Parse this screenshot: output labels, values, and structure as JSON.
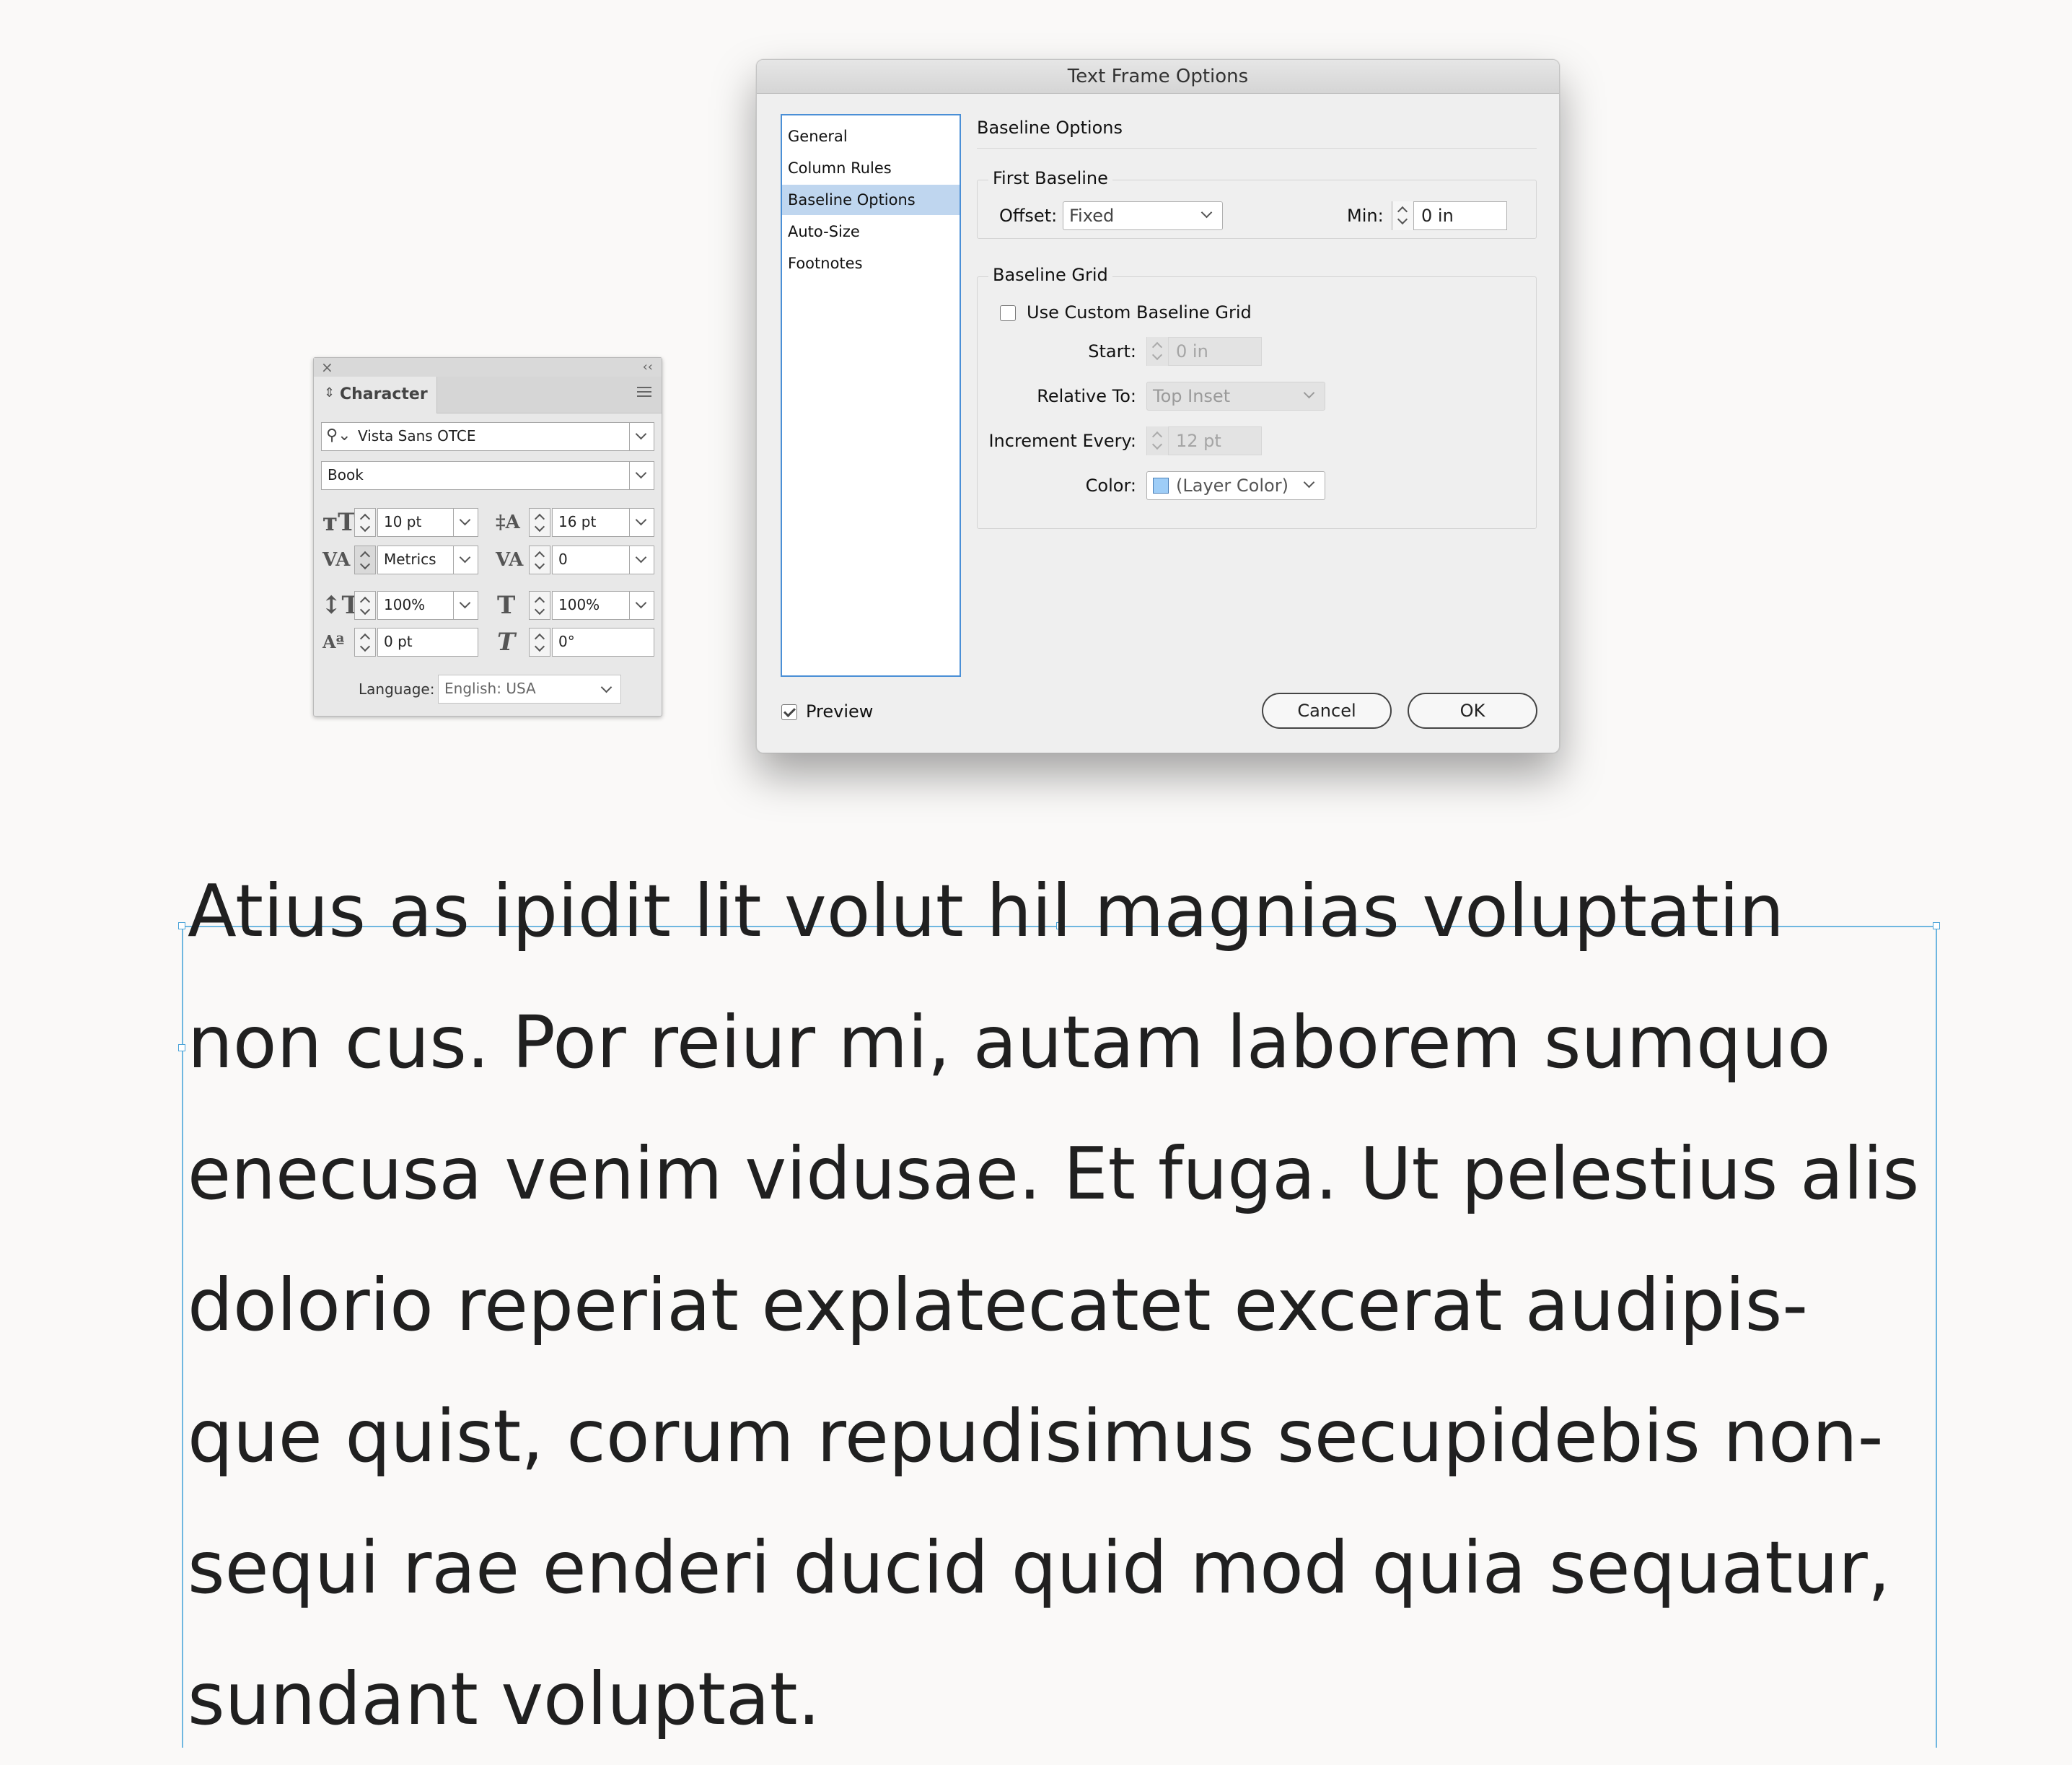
{
  "character_panel": {
    "tab_label": "Character",
    "font_family": "Vista Sans OTCE",
    "font_style": "Book",
    "font_size": "10 pt",
    "leading": "16 pt",
    "kerning": "Metrics",
    "tracking": "0",
    "vertical_scale": "100%",
    "horizontal_scale": "100%",
    "baseline_shift": "0 pt",
    "skew": "0°",
    "language_label": "Language:",
    "language": "English: USA"
  },
  "dialog": {
    "title": "Text Frame Options",
    "nav_items": [
      "General",
      "Column Rules",
      "Baseline Options",
      "Auto-Size",
      "Footnotes"
    ],
    "selected_nav": "Baseline Options",
    "section_title": "Baseline Options",
    "first_baseline": {
      "group_label": "First Baseline",
      "offset_label": "Offset:",
      "offset_value": "Fixed",
      "min_label": "Min:",
      "min_value": "0 in"
    },
    "baseline_grid": {
      "group_label": "Baseline Grid",
      "use_custom_label": "Use Custom Baseline Grid",
      "use_custom_checked": false,
      "start_label": "Start:",
      "start_value": "0 in",
      "relative_to_label": "Relative To:",
      "relative_to_value": "Top Inset",
      "increment_label": "Increment Every:",
      "increment_value": "12 pt",
      "color_label": "Color:",
      "color_value": "(Layer Color)",
      "color_swatch": "#9ecdf7"
    },
    "preview_label": "Preview",
    "preview_checked": true,
    "cancel_label": "Cancel",
    "ok_label": "OK"
  },
  "body_text": {
    "lines": [
      "Atius as ipidit lit volut hil magnias voluptatin",
      "non cus. Por reiur mi, autam laborem sumquo",
      "enecusa venim vidusae. Et fuga. Ut pelestius alis",
      "dolorio reperiat explatecatet excerat audipis-",
      "que quist, corum repudisimus secupidebis non-",
      "sequi rae enderi ducid quid mod quia sequatur,",
      "sundant voluptat."
    ]
  },
  "colors": {
    "frame_edge": "#6fb7e0",
    "nav_selection": "#bfd6ef",
    "nav_border": "#4a8fd6"
  }
}
